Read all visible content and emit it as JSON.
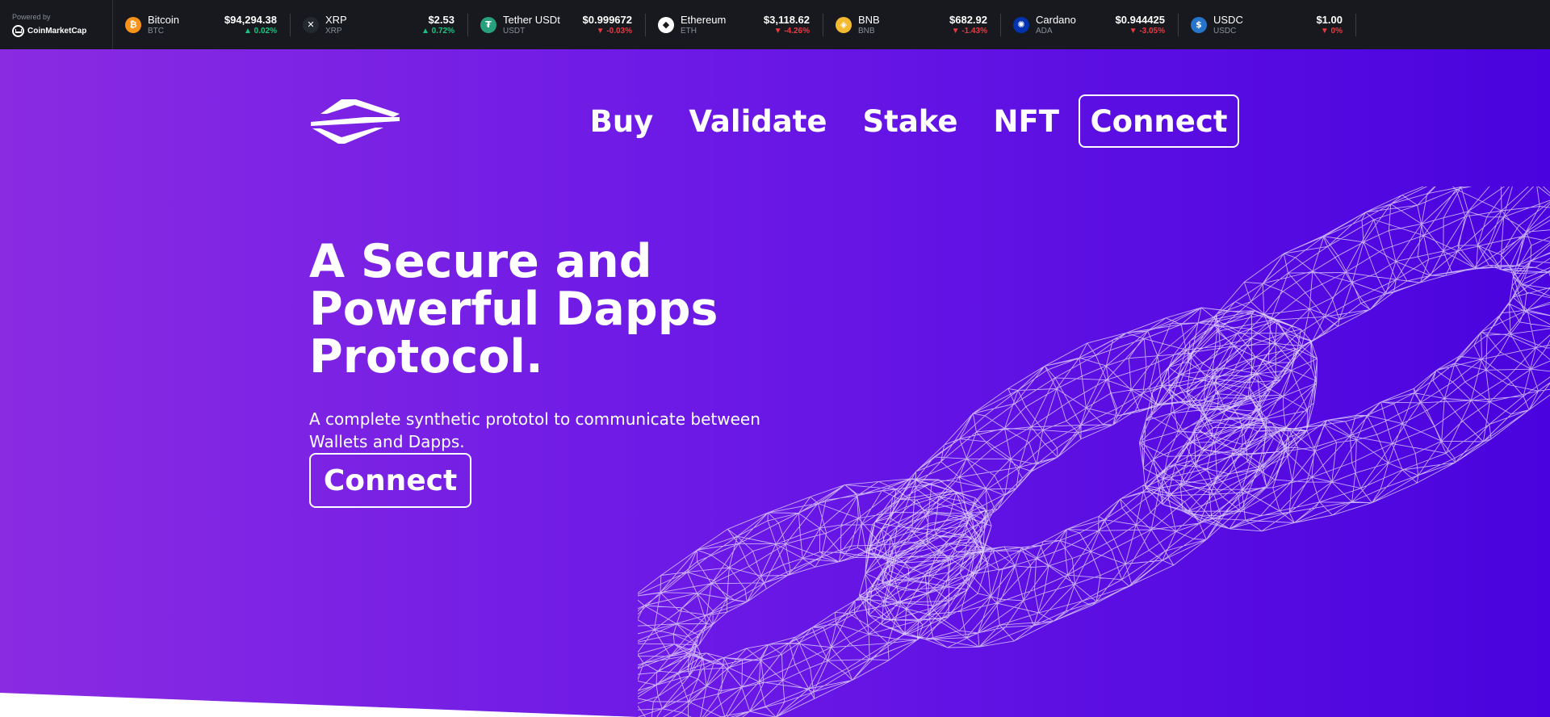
{
  "ticker": {
    "powered_by": "Powered by",
    "brand": "CoinMarketCap",
    "coins": [
      {
        "name": "Bitcoin",
        "symbol": "BTC",
        "price": "$94,294.38",
        "change": "0.02%",
        "direction": "up",
        "icon": "bitcoin-icon",
        "color": "#f7931a",
        "glyph": "₿"
      },
      {
        "name": "XRP",
        "symbol": "XRP",
        "price": "$2.53",
        "change": "0.72%",
        "direction": "up",
        "icon": "xrp-icon",
        "color": "#23292f",
        "glyph": "✕"
      },
      {
        "name": "Tether USDt",
        "symbol": "USDT",
        "price": "$0.999672",
        "change": "-0.03%",
        "direction": "down",
        "icon": "tether-icon",
        "color": "#26a17b",
        "glyph": "₮"
      },
      {
        "name": "Ethereum",
        "symbol": "ETH",
        "price": "$3,118.62",
        "change": "-4.26%",
        "direction": "down",
        "icon": "ethereum-icon",
        "color": "#ffffff",
        "glyph": "◆"
      },
      {
        "name": "BNB",
        "symbol": "BNB",
        "price": "$682.92",
        "change": "-1.43%",
        "direction": "down",
        "icon": "bnb-icon",
        "color": "#f3ba2f",
        "glyph": "◈"
      },
      {
        "name": "Cardano",
        "symbol": "ADA",
        "price": "$0.944425",
        "change": "-3.05%",
        "direction": "down",
        "icon": "cardano-icon",
        "color": "#0033ad",
        "glyph": "✺"
      },
      {
        "name": "USDC",
        "symbol": "USDC",
        "price": "$1.00",
        "change": "0%",
        "direction": "down",
        "icon": "usdc-icon",
        "color": "#2775ca",
        "glyph": "$"
      }
    ]
  },
  "nav": {
    "items": [
      "Buy",
      "Validate",
      "Stake",
      "NFT"
    ],
    "connect_label": "Connect"
  },
  "hero": {
    "headline_lines": [
      "A Secure and",
      "Powerful Dapps",
      "Protocol."
    ],
    "subtitle": "A complete synthetic prototol to communicate between Wallets and Dapps.",
    "connect_label": "Connect"
  },
  "colors": {
    "ticker_bg": "#17191e",
    "gradient_start": "#8a2be2",
    "gradient_end": "#4a03de",
    "up": "#16c784",
    "down": "#ea3943"
  }
}
